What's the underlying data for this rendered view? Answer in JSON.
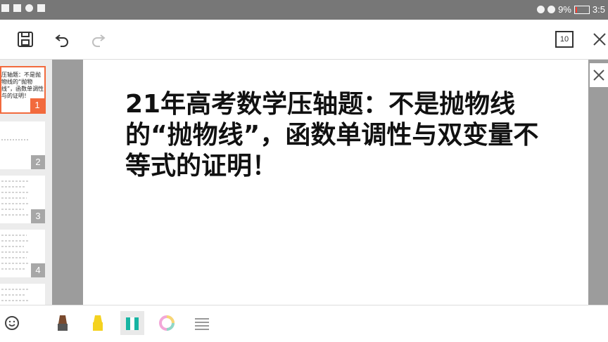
{
  "statusbar": {
    "battery_percent": "9%",
    "time": "3:5"
  },
  "toolbar": {
    "page_count": "10"
  },
  "slides": [
    {
      "number": "1",
      "preview_text": "压轴题：不是抛物线的“抛物线”，函数单调性与的证明！"
    },
    {
      "number": "2"
    },
    {
      "number": "3"
    },
    {
      "number": "4"
    }
  ],
  "slide": {
    "title": "21年高考数学压轴题：不是抛物线的“抛物线”，函数单调性与双变量不等式的证明！"
  },
  "colors": {
    "accent": "#f26a3d",
    "pen_brown": "#7a4a2e",
    "highlighter_yellow": "#f4d21f",
    "teal_marker": "#17b5a3"
  }
}
